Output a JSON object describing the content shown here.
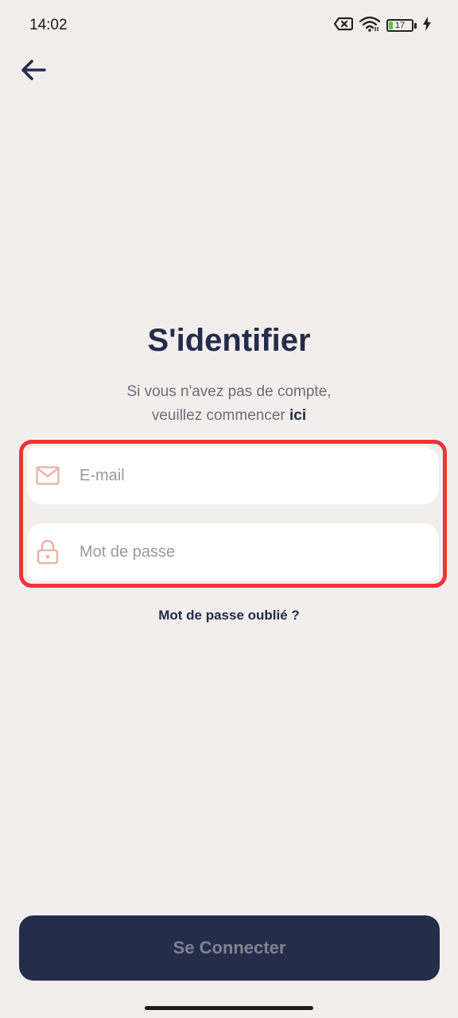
{
  "status_bar": {
    "time": "14:02",
    "battery_level": "17",
    "battery_fraction": 0.17,
    "icons": [
      "sim-off-icon",
      "wifi-icon",
      "battery-icon",
      "charging-icon"
    ]
  },
  "header": {
    "back_icon": "arrow-left-icon"
  },
  "main": {
    "title": "S'identifier",
    "subtitle_line1": "Si vous n'avez pas de compte,",
    "subtitle_line2_prefix": "veuillez commencer ",
    "subtitle_link": "ici",
    "email_field": {
      "placeholder": "E-mail",
      "value": "",
      "icon": "mail-icon"
    },
    "password_field": {
      "placeholder": "Mot de passe",
      "value": "",
      "icon": "lock-icon"
    },
    "forgot_password": "Mot de passe oublié ?",
    "connect_button": "Se Connecter"
  },
  "colors": {
    "background": "#f2eeed",
    "primary": "#232c4a",
    "highlight_frame": "#f2323a",
    "icon_tint": "#e8b6a8",
    "button_text_disabled": "#7e8292"
  }
}
